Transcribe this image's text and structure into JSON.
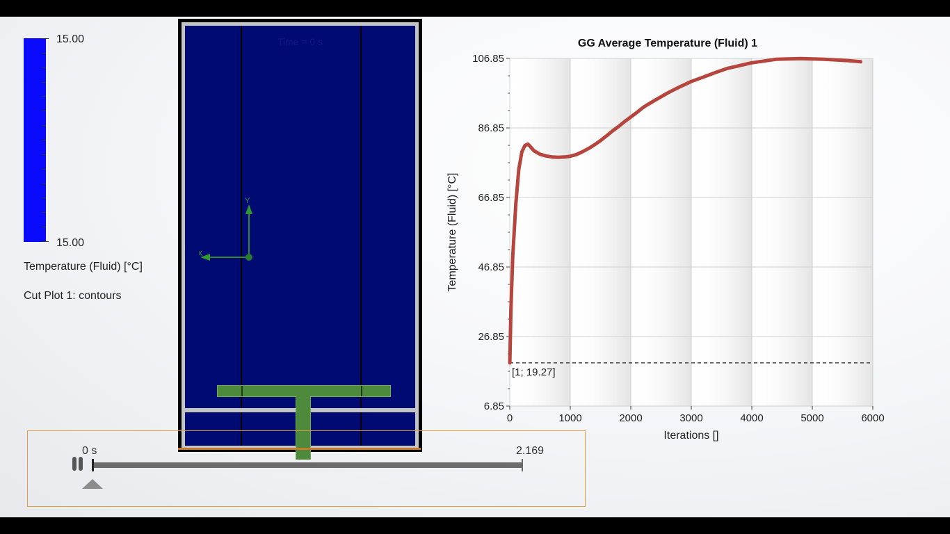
{
  "legend": {
    "max_value": "15.00",
    "min_value": "15.00",
    "quantity": "Temperature (Fluid) [°C]",
    "plot_name": "Cut Plot 1: contours",
    "color": "#0a0aff"
  },
  "model_view": {
    "time_label": "Time = 0 s",
    "axis_y": "Y",
    "axis_x": "X",
    "fluid_color": "#000a73",
    "solid_color": "#4d8a3c"
  },
  "chart_data": {
    "type": "line",
    "title": "GG Average Temperature (Fluid) 1",
    "xlabel": "Iterations []",
    "ylabel": "Temperature (Fluid) [°C]",
    "xlim": [
      0,
      6000
    ],
    "ylim": [
      6.85,
      106.85
    ],
    "xticks": [
      "0",
      "1000",
      "2000",
      "3000",
      "4000",
      "5000",
      "6000"
    ],
    "yticks": [
      "6.85",
      "26.85",
      "46.85",
      "66.85",
      "86.85",
      "106.85"
    ],
    "grid": true,
    "series": [
      {
        "color": "#b5453d",
        "x": [
          1,
          20,
          50,
          100,
          150,
          200,
          250,
          300,
          350,
          400,
          500,
          600,
          700,
          800,
          900,
          1000,
          1100,
          1200,
          1300,
          1400,
          1500,
          1600,
          1700,
          1800,
          1900,
          2000,
          2100,
          2200,
          2300,
          2400,
          2500,
          2600,
          2700,
          2800,
          2900,
          3000,
          3200,
          3400,
          3600,
          3800,
          4000,
          4200,
          4400,
          4600,
          4800,
          5000,
          5200,
          5400,
          5600,
          5800
        ],
        "y": [
          19.27,
          35,
          50,
          65,
          75,
          80,
          81.8,
          82.2,
          81.3,
          80.3,
          79.3,
          78.8,
          78.5,
          78.4,
          78.5,
          78.7,
          79.2,
          80,
          80.9,
          82,
          83.2,
          84.6,
          86,
          87.3,
          88.7,
          90,
          91.3,
          92.7,
          93.8,
          94.8,
          95.8,
          96.8,
          97.7,
          98.6,
          99.4,
          100.2,
          101.5,
          102.8,
          104,
          104.8,
          105.6,
          106.1,
          106.6,
          106.7,
          106.8,
          106.7,
          106.6,
          106.4,
          106.2,
          105.9
        ]
      }
    ],
    "reference_value": 19.27,
    "annotation": "[1; 19.27]"
  },
  "timeline": {
    "start_label": "0 s",
    "end_label": "2.169",
    "progress": 0
  }
}
